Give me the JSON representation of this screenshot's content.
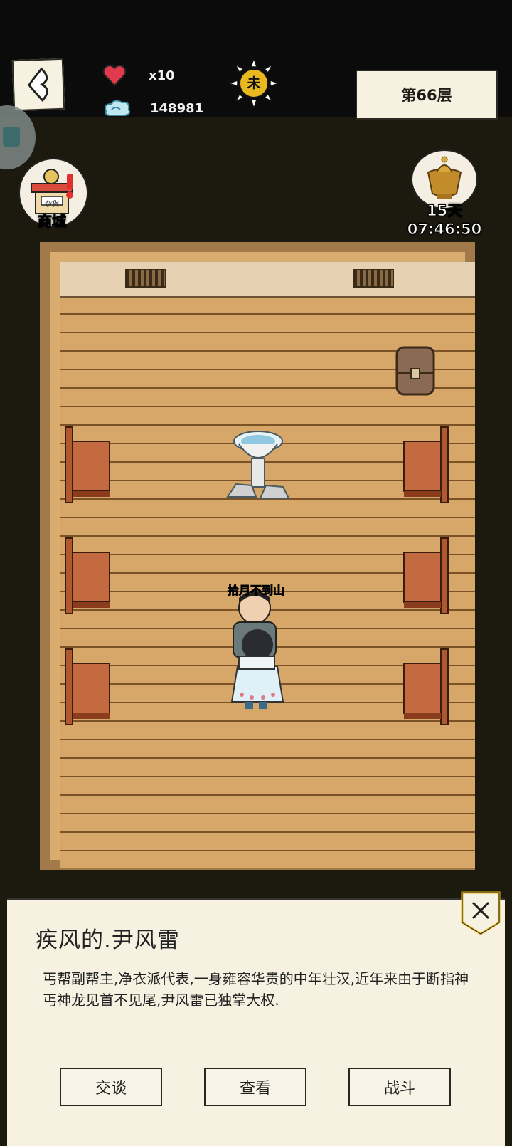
{
  "hud": {
    "lives": "x10",
    "coins": "148981",
    "time_glyph": "未",
    "floor": "第66层"
  },
  "shop": {
    "label": "商城",
    "sign": "杂货"
  },
  "event": {
    "timer": "15天07:46:50"
  },
  "scene": {
    "npc_name": "拾月不到山"
  },
  "dialog": {
    "title": "疾风的.尹风雷",
    "description": "丐帮副帮主,净衣派代表,一身雍容华贵的中年壮汉,近年来由于断指神丐神龙见首不见尾,尹风雷已独掌大权.",
    "buttons": {
      "talk": "交谈",
      "view": "查看",
      "fight": "战斗"
    }
  },
  "colors": {
    "accent_gold": "#e8b81e",
    "floor_wood": "#d6a768",
    "paper": "#f6f1e1"
  }
}
